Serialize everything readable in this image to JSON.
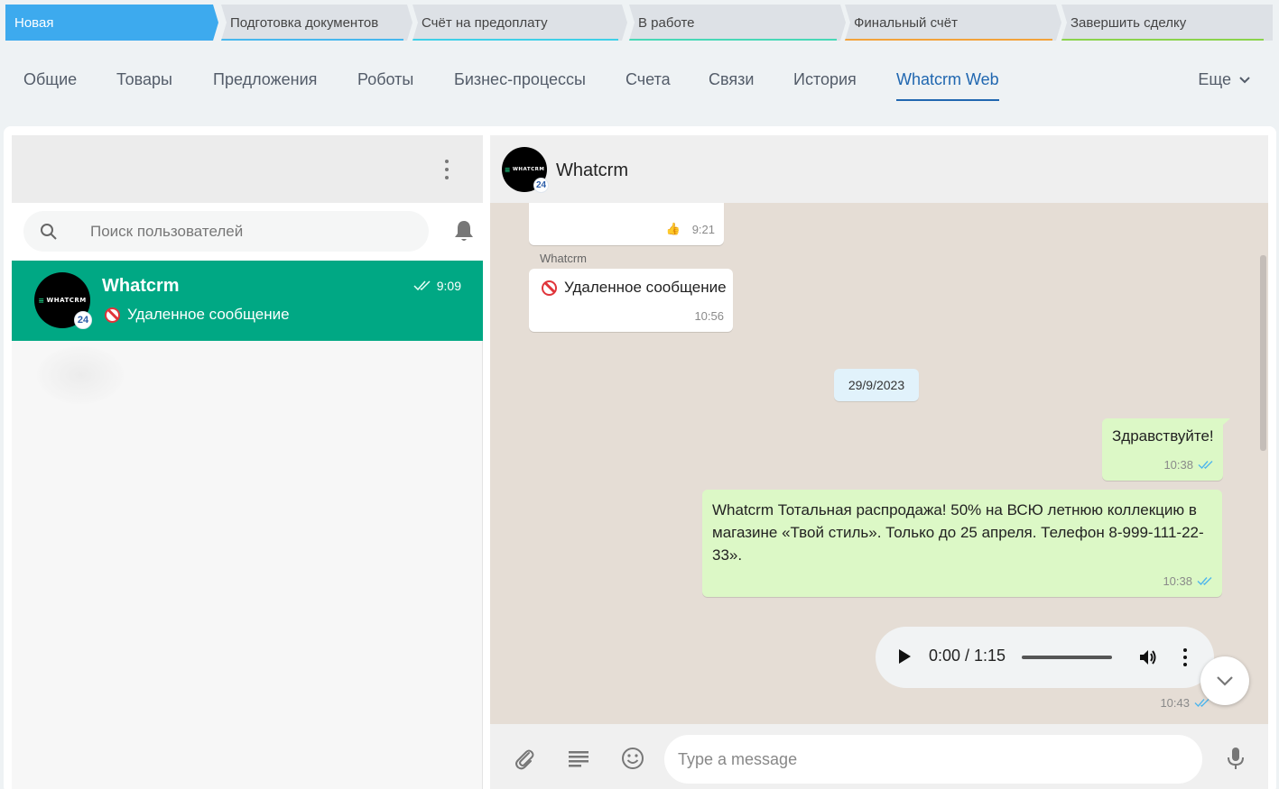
{
  "stages": [
    {
      "label": "Новая",
      "color": "#3daaee"
    },
    {
      "label": "Подготовка документов",
      "color": "#47b7ee"
    },
    {
      "label": "Счёт на предоплату",
      "color": "#3fd0e8"
    },
    {
      "label": "В работе",
      "color": "#48d8b7"
    },
    {
      "label": "Финальный счёт",
      "color": "#f3a33b"
    },
    {
      "label": "Завершить сделку",
      "color": "#8bd34c"
    }
  ],
  "tabs": [
    "Общие",
    "Товары",
    "Предложения",
    "Роботы",
    "Бизнес-процессы",
    "Счета",
    "Связи",
    "История",
    "Whatcrm Web"
  ],
  "more_label": "Еще",
  "search": {
    "placeholder": "Поиск пользователей"
  },
  "avatar": {
    "logo_text": "WHATCRM",
    "badge": "24"
  },
  "chat_list": [
    {
      "name": "Whatcrm",
      "time": "9:09",
      "preview": "Удаленное сообщение"
    }
  ],
  "conversation": {
    "title": "Whatcrm",
    "msg1": {
      "reaction": "👍",
      "time": "9:21"
    },
    "sender": "Whatcrm",
    "msg2": {
      "text": "Удаленное сообщение",
      "time": "10:56"
    },
    "date_chip": "29/9/2023",
    "msg3": {
      "text": "Здравствуйте!",
      "time": "10:38"
    },
    "msg4": {
      "text": "Whatcrm  Тотальная распродажа! 50% на ВСЮ летнюю коллекцию в магазине «Твой стиль». Только до 25 апреля. Телефон 8-999-111-22-33».",
      "time": "10:38"
    },
    "audio": {
      "time_label": "0:00 / 1:15",
      "time": "10:43"
    }
  },
  "composer": {
    "placeholder": "Type a message"
  },
  "colors": {
    "active_stage": "#3daaee",
    "chat_active": "#00a884",
    "tab_active": "#2067b0",
    "outgoing_bubble": "#dcf8c6"
  }
}
